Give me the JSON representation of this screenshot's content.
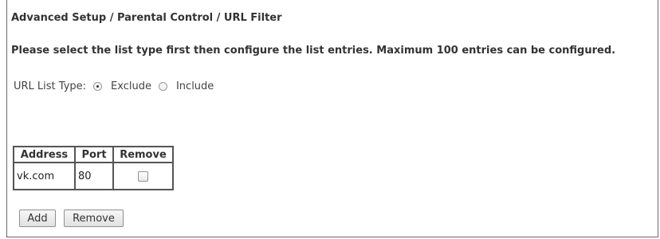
{
  "breadcrumb": "Advanced Setup / Parental Control / URL Filter",
  "description": "Please select the list type first then configure the list entries. Maximum 100 entries can be configured.",
  "list_type": {
    "label": "URL List Type:",
    "options": [
      {
        "label": "Exclude",
        "selected": true
      },
      {
        "label": "Include",
        "selected": false
      }
    ]
  },
  "table": {
    "headers": [
      "Address",
      "Port",
      "Remove"
    ],
    "rows": [
      {
        "address": "vk.com",
        "port": "80",
        "remove_checked": false
      }
    ]
  },
  "buttons": {
    "add": "Add",
    "remove": "Remove"
  }
}
